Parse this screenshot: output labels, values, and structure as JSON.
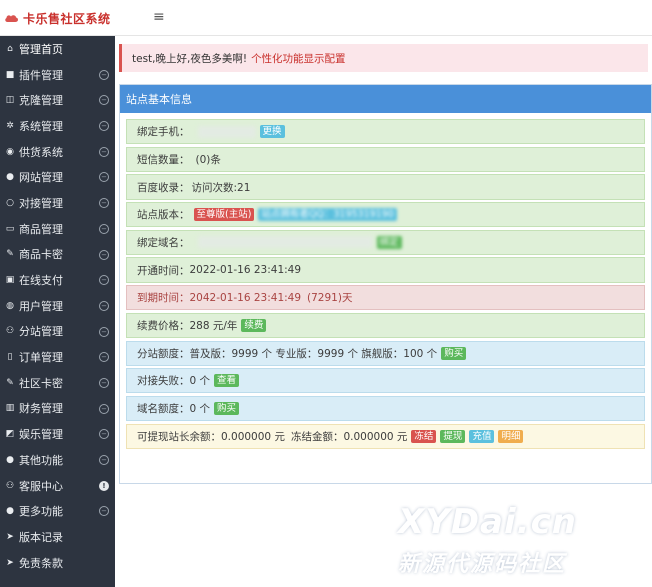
{
  "app": {
    "title": "卡乐售社区系统",
    "menu_toggle": "≡",
    "accent": "#c9302c"
  },
  "sidebar": {
    "items": [
      {
        "icon": "home-icon",
        "glyph": "⌂",
        "label": "管理首页",
        "arrow": false
      },
      {
        "icon": "lock-icon",
        "glyph": "■",
        "label": "插件管理",
        "arrow": true
      },
      {
        "icon": "clone-icon",
        "glyph": "◫",
        "label": "克隆管理",
        "arrow": true
      },
      {
        "icon": "cogs-icon",
        "glyph": "✲",
        "label": "系统管理",
        "arrow": true
      },
      {
        "icon": "supply-icon",
        "glyph": "◉",
        "label": "供货系统",
        "arrow": true
      },
      {
        "icon": "globe-icon",
        "glyph": "●",
        "label": "网站管理",
        "arrow": true
      },
      {
        "icon": "power-icon",
        "glyph": "○",
        "label": "对接管理",
        "arrow": true
      },
      {
        "icon": "product-icon",
        "glyph": "▭",
        "label": "商品管理",
        "arrow": true
      },
      {
        "icon": "key-icon",
        "glyph": "✎",
        "label": "商品卡密",
        "arrow": true
      },
      {
        "icon": "payment-icon",
        "glyph": "▣",
        "label": "在线支付",
        "arrow": true
      },
      {
        "icon": "user-icon",
        "glyph": "◍",
        "label": "用户管理",
        "arrow": true
      },
      {
        "icon": "sitemap-icon",
        "glyph": "⚇",
        "label": "分站管理",
        "arrow": true
      },
      {
        "icon": "order-icon",
        "glyph": "▯",
        "label": "订单管理",
        "arrow": true
      },
      {
        "icon": "community-key-icon",
        "glyph": "✎",
        "label": "社区卡密",
        "arrow": true
      },
      {
        "icon": "finance-icon",
        "glyph": "▥",
        "label": "财务管理",
        "arrow": true
      },
      {
        "icon": "entertainment-icon",
        "glyph": "◩",
        "label": "娱乐管理",
        "arrow": true
      },
      {
        "icon": "apple-icon",
        "glyph": "●",
        "label": "其他功能",
        "arrow": true
      },
      {
        "icon": "customer-service-icon",
        "glyph": "⚇",
        "label": "客服中心",
        "arrow": false,
        "dot": "!"
      },
      {
        "icon": "apple-icon",
        "glyph": "●",
        "label": "更多功能",
        "arrow": true
      },
      {
        "icon": "send-icon",
        "glyph": "➤",
        "label": "版本记录",
        "arrow": false
      },
      {
        "icon": "send-icon",
        "glyph": "➤",
        "label": "免责条款",
        "arrow": false
      }
    ],
    "arrow_glyph": "⊖"
  },
  "welcome": {
    "text": "test,晚上好,夜色多美啊!",
    "link": "个性化功能显示配置"
  },
  "panel": {
    "title": "站点基本信息",
    "rows": {
      "phone": {
        "label": "绑定手机：",
        "btn": "更换"
      },
      "sms": {
        "label": "短信数量：",
        "value": "(0)条"
      },
      "baidu": {
        "label": "百度收录：",
        "value": "访问次数:21"
      },
      "version": {
        "label": "站点版本：",
        "badge1": "至尊版(主站)",
        "badge2": "站点拥有者QQ：3195319190"
      },
      "domain": {
        "label": "绑定域名：",
        "btn": "绑定"
      },
      "open_time": {
        "label": "开通时间：",
        "value": "2022-01-16 23:41:49"
      },
      "expire": {
        "label": "到期时间：",
        "value": "2042-01-16 23:41:49",
        "days": "(7291)天"
      },
      "renew": {
        "label": "续费价格：",
        "value": "288 元/年",
        "btn": "续费"
      },
      "quota": {
        "label": "分站额度：",
        "value": "普及版：9999 个 专业版：9999 个 旗舰版：100 个",
        "btn": "购买"
      },
      "dock_fail": {
        "label": "对接失败：",
        "value": "0 个",
        "btn": "查看"
      },
      "domain_quota": {
        "label": "域名额度：",
        "value": "0 个",
        "btn": "购买"
      },
      "balance": {
        "label": "可提现站长余额：",
        "value": "0.000000 元",
        "frozen_label": "冻结金额：",
        "frozen_value": "0.000000 元",
        "btn1": "冻结",
        "btn2": "提现",
        "btn3": "充值",
        "btn4": "明细"
      }
    }
  },
  "watermark": {
    "line1": "XYDai.cn",
    "line2": "新源代源码社区"
  }
}
